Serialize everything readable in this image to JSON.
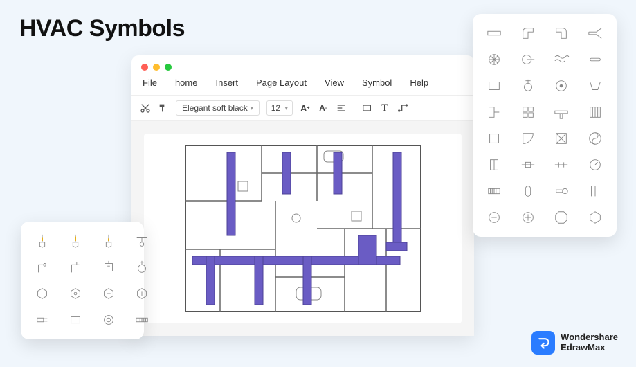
{
  "title": "HVAC Symbols",
  "menu": [
    "File",
    "home",
    "Insert",
    "Page Layout",
    "View",
    "Symbol",
    "Help"
  ],
  "toolbar": {
    "font_name": "Elegant soft black",
    "font_size": "12"
  },
  "brand": {
    "line1": "Wondershare",
    "line2": "EdrawMax"
  },
  "right_panel": {
    "cols": 4,
    "symbols": [
      "duct-straight",
      "duct-elbow-1",
      "duct-elbow-2",
      "duct-branch",
      "fan-impeller",
      "blower",
      "waveform",
      "cylinder",
      "rect-open",
      "valve-round",
      "dot-circle",
      "trap",
      "connector-l",
      "grid-4",
      "flow-tee",
      "panel-lines",
      "box",
      "quarter",
      "x-box",
      "yin",
      "split-vert",
      "slider-h",
      "bar-valve",
      "gauge",
      "vent",
      "capsule",
      "handle",
      "lines-3",
      "coin",
      "plus-circle",
      "stop-oct",
      "hex"
    ]
  },
  "left_panel": {
    "cols": 4,
    "symbols": [
      "thermo-1",
      "thermo-2",
      "thermo-3",
      "light-fix",
      "tap-1",
      "tap-2",
      "box-switch",
      "dial",
      "hex-a",
      "hex-b",
      "hex-c",
      "hex-d",
      "plug",
      "block",
      "ring",
      "scale"
    ]
  }
}
